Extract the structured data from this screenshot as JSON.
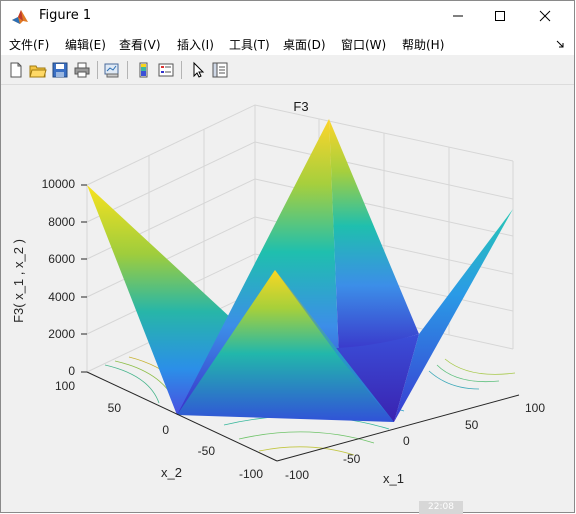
{
  "window": {
    "title": "Figure 1",
    "controls": {
      "minimize": "minimize",
      "maximize": "maximize",
      "close": "close"
    }
  },
  "menu": [
    {
      "label": "文件(F)"
    },
    {
      "label": "编辑(E)"
    },
    {
      "label": "查看(V)"
    },
    {
      "label": "插入(I)"
    },
    {
      "label": "工具(T)"
    },
    {
      "label": "桌面(D)"
    },
    {
      "label": "窗口(W)"
    },
    {
      "label": "帮助(H)"
    }
  ],
  "toolbar": {
    "icons": [
      "new-figure-icon",
      "open-file-icon",
      "save-icon",
      "print-icon",
      "link-plot-icon",
      "colorbar-icon",
      "legend-icon",
      "pointer-icon",
      "property-inspector-icon"
    ]
  },
  "chart_data": {
    "type": "surface3d",
    "title": "F3",
    "zlabel": "F3( x_1 , x_2 )",
    "xlabel": "x_1",
    "ylabel": "x_2",
    "z_ticks": [
      "0",
      "2000",
      "4000",
      "6000",
      "8000",
      "10000"
    ],
    "x_ticks": [
      "-100",
      "-50",
      "0",
      "50",
      "100"
    ],
    "y_ticks": [
      "-100",
      "-50",
      "0",
      "50",
      "100"
    ],
    "xlim": [
      -100,
      100
    ],
    "ylim": [
      -100,
      100
    ],
    "zlim": [
      0,
      10000
    ],
    "colormap": "parula",
    "grid": true,
    "contour_on_floor": true
  },
  "status_ghost": "22:08"
}
